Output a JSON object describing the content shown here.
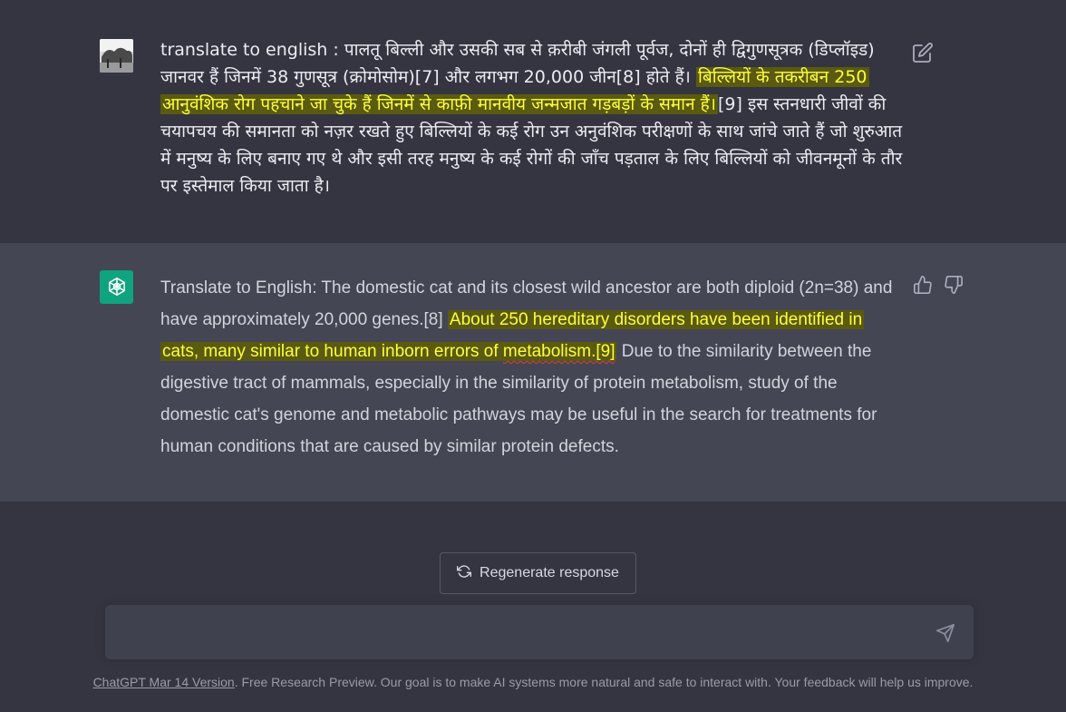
{
  "user_message": {
    "text_part1": "translate to english : पालतू बिल्ली और उसकी सब से क़रीबी जंगली पूर्वज, दोनों ही द्विगुणसूत्रक (डिप्लॉइड) जानवर हैं जिनमें 38 गुणसूत्र (क्रोमोसोम)[7] और लगभग 20,000 जीन[8] होते हैं। ",
    "highlight": "बिल्लियों के तकरीबन 250 आनुवंशिक रोग पहचाने जा चुके हैं जिनमें से काफ़ी मानवीय जन्मजात गड़बड़ों के समान हैं।",
    "text_part2": "[9] इस स्तनधारी जीवों की चयापचय की समानता को नज़र रखते हुए बिल्लियों के कई रोग उन अनुवंशिक परीक्षणों के साथ जांचे जाते हैं जो शुरुआत में मनुष्य के लिए बनाए गए थे और इसी तरह मनुष्य के कई रोगों की जाँच पड़ताल के लिए बिल्लियों को जीवनमूनों के तौर पर इस्तेमाल किया जाता है।"
  },
  "assistant_message": {
    "text_part1": "Translate to English: The domestic cat and its closest wild ancestor are both diploid (2n=38) and have approximately 20,000 genes.[8] ",
    "highlight_a": "About 250 hereditary disorders have been identified in cats, many similar to human inborn errors of ",
    "highlight_b": "metabolism.[9]",
    "text_part2": " Due to the similarity between the digestive tract of mammals, especially in the similarity of protein metabolism, study of the domestic cat's genome and metabolic pathways may be useful in the search for treatments for human conditions that are caused by similar protein defects."
  },
  "regenerate_label": "Regenerate response",
  "input_placeholder": "",
  "footer": {
    "link_text": "ChatGPT Mar 14 Version",
    "text": ". Free Research Preview. Our goal is to make AI systems more natural and safe to interact with. Your feedback will help us improve."
  },
  "icons": {
    "edit": "edit-icon",
    "thumb_up": "thumbs-up-icon",
    "thumb_down": "thumbs-down-icon",
    "regenerate": "refresh-icon",
    "send": "send-icon",
    "assistant_logo": "openai-logo-icon"
  },
  "colors": {
    "bg": "#343541",
    "assistant_bg": "#444654",
    "highlight_bg": "#5a5a10",
    "highlight_text": "#ffff3c",
    "brand": "#10a37f"
  }
}
